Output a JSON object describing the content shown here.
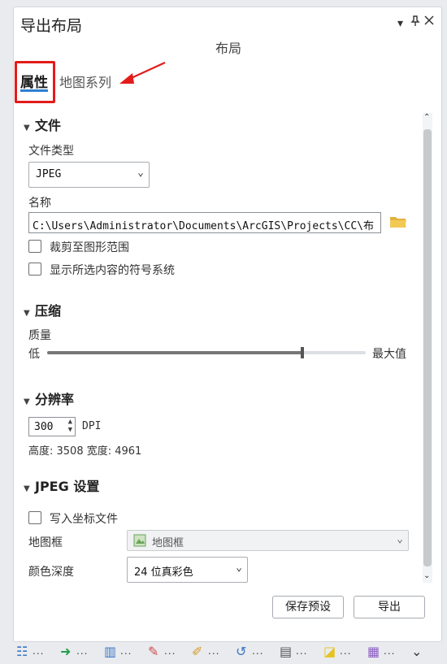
{
  "pane": {
    "title": "导出布局",
    "pin_icon": "pin-icon",
    "close_icon": "close-icon",
    "subtitle": "布局"
  },
  "tabs": [
    {
      "label": "属性",
      "active": true
    },
    {
      "label": "地图系列",
      "active": false
    }
  ],
  "colors": {
    "accent": "#2e7fd1",
    "annotation": "#e31b1b",
    "folder": "#e3b23c"
  },
  "sections": {
    "file": {
      "title": "文件",
      "file_type_label": "文件类型",
      "file_type_value": "JPEG",
      "name_label": "名称",
      "name_value": "C:\\Users\\Administrator\\Documents\\ArcGIS\\Projects\\CC\\布",
      "clip_label": "裁剪至图形范围",
      "symbology_label": "显示所选内容的符号系统"
    },
    "compression": {
      "title": "压缩",
      "quality_label": "质量",
      "min_label": "低",
      "max_label": "最大值",
      "quality_level": 0.8
    },
    "resolution": {
      "title": "分辨率",
      "dpi_value": "300",
      "dpi_unit": "DPI",
      "size_text": "高度: 3508 宽度: 4961"
    },
    "jpeg": {
      "title": "JPEG 设置",
      "world_file_label": "写入坐标文件",
      "map_frame_label": "地图框",
      "map_frame_value": "地图框",
      "color_depth_label": "颜色深度",
      "color_depth_value": "24 位真彩色"
    }
  },
  "buttons": {
    "save_preset": "保存预设",
    "export": "导出"
  },
  "bottom_tools": [
    {
      "icon": "contents-icon",
      "glyph": "☷",
      "color": "#3a76c4",
      "dots": "..."
    },
    {
      "icon": "arrow-right-icon",
      "glyph": "➜",
      "color": "#22a04b",
      "dots": "..."
    },
    {
      "icon": "chart-icon",
      "glyph": "▥",
      "color": "#3a76c4",
      "dots": "..."
    },
    {
      "icon": "edit-icon",
      "glyph": "✎",
      "color": "#d14b4b",
      "dots": "..."
    },
    {
      "icon": "tag-icon",
      "glyph": "✐",
      "color": "#d89a22",
      "dots": "..."
    },
    {
      "icon": "history-icon",
      "glyph": "↺",
      "color": "#3a76c4",
      "dots": "..."
    },
    {
      "icon": "document-icon",
      "glyph": "▤",
      "color": "#555555",
      "dots": "..."
    },
    {
      "icon": "highlight-icon",
      "glyph": "◪",
      "color": "#e6c21e",
      "dots": "..."
    },
    {
      "icon": "form-icon",
      "glyph": "▦",
      "color": "#8a5cc4",
      "dots": "..."
    },
    {
      "icon": "chevron-down-icon",
      "glyph": "⌄",
      "color": "#333333",
      "dots": ""
    }
  ]
}
